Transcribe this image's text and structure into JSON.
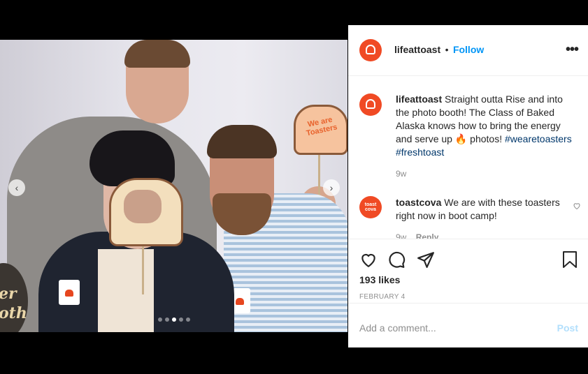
{
  "post": {
    "account": "lifeattoast",
    "follow_sep": "•",
    "follow_label": "Follow",
    "more_label": "•••",
    "caption_user": "lifeattoast",
    "caption_text": "Straight outta Rise and into the photo booth! The Class of Baked Alaska knows how to bring the energy and serve up",
    "caption_emoji": "🔥",
    "caption_after": " photos!",
    "hashtag1": "#wearetoasters",
    "hashtag2": "#freshtoast",
    "caption_time": "9w",
    "likes": "193 likes",
    "date": "FEBRUARY 4",
    "comment_placeholder": "Add a comment...",
    "post_label": "Post"
  },
  "comment": {
    "user": "toastcova",
    "text": "We are with these toasters right now in boot camp!",
    "avatar_text": "toast",
    "avatar_sub": "cova",
    "time": "9w",
    "reply": "Reply"
  },
  "photo": {
    "sign_text": "We are Toasters",
    "round_sign_text": "er\noth",
    "carousel_count": 5,
    "carousel_active": 2
  },
  "colors": {
    "brand": "#f04a24",
    "link": "#0095f6",
    "hashtag": "#00376b"
  },
  "icons": [
    "three-dots-icon",
    "heart-icon",
    "comment-icon",
    "share-icon",
    "bookmark-icon",
    "small-heart-icon",
    "chevron-left-icon",
    "chevron-right-icon"
  ]
}
